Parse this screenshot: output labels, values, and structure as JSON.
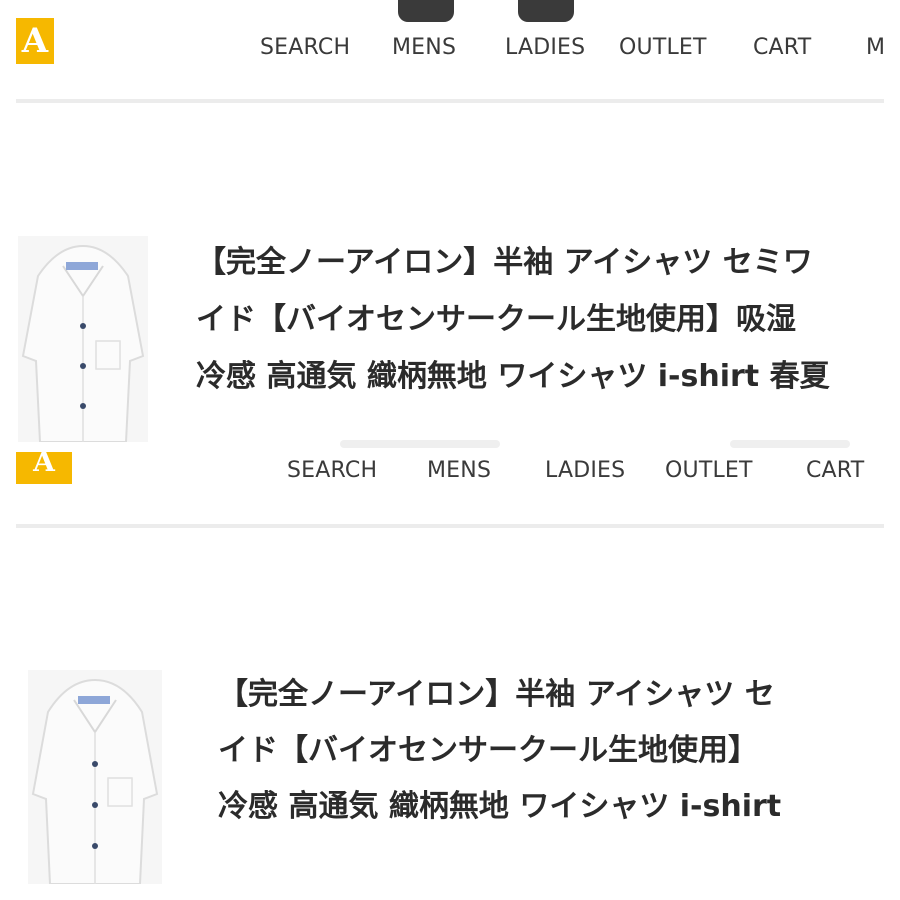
{
  "logo_letter": "A",
  "panels": [
    {
      "nav": [
        "SEARCH",
        "MENS",
        "LADIES",
        "OUTLET",
        "CART",
        "M"
      ],
      "product": {
        "title_lines": [
          "【完全ノーアイロン】半袖 アイシャツ セミワ",
          "イド【バイオセンサークール生地使用】吸湿",
          "冷感 高通気 織柄無地 ワイシャツ i-shirt 春夏"
        ]
      }
    },
    {
      "nav": [
        "SEARCH",
        "MENS",
        "LADIES",
        "OUTLET",
        "CART"
      ],
      "product": {
        "title_lines": [
          "【完全ノーアイロン】半袖 アイシャツ セ",
          "イド【バイオセンサークール生地使用】",
          "冷感 高通気 織柄無地 ワイシャツ i-shirt"
        ]
      }
    }
  ],
  "colors": {
    "brand": "#f6b800",
    "text": "#2b2b2b",
    "nav_text": "#3a3a3a"
  },
  "icons": [
    "shirt-image-icon"
  ]
}
